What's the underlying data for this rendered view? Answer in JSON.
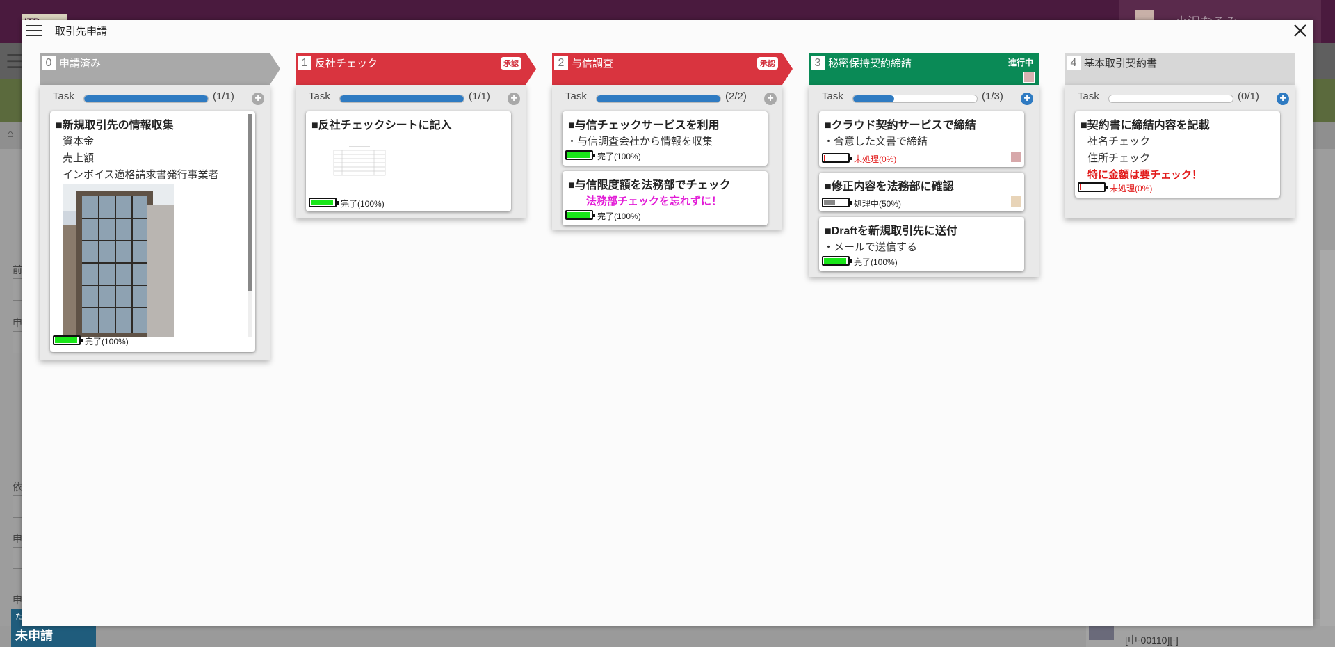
{
  "background": {
    "logo": "ITP",
    "user_name": "小沢なるみ",
    "field_labels": [
      "前",
      "申",
      "依",
      "申",
      "申"
    ],
    "status_badge": "未申請",
    "status_prefix": "た",
    "bottom_code": "[申-00110][-]"
  },
  "modal": {
    "title": "取引先申請",
    "task_label": "Task"
  },
  "colors": {
    "grey_stage": "#a9a9a9",
    "red_stage": "#d9343f",
    "green_stage": "#0a8a56",
    "light_stage": "#d7d7d7",
    "progress_fill": "#2f7bc2",
    "battery_full": "#19e619",
    "battery_half": "#888888",
    "battery_empty": "#e21b1b",
    "magenta_note": "#e21bd6",
    "red_note": "#e21b1b"
  },
  "stages": [
    {
      "num": "0",
      "name": "申請済み",
      "task_count": "(1/1)",
      "progress": 1.0,
      "cards": [
        {
          "title": "■新規取引先の情報収集",
          "lines": [
            "資本金",
            "売上額",
            "インボイス適格請求書発行事業者"
          ],
          "image": "building-photo",
          "status": "完了(100%)",
          "level": 1.0
        }
      ]
    },
    {
      "num": "1",
      "name": "反社チェック",
      "badge": "承認",
      "task_count": "(1/1)",
      "progress": 1.0,
      "cards": [
        {
          "title": "■反社チェックシートに記入",
          "image": "checksheet-thumbnail",
          "status": "完了(100%)",
          "level": 1.0
        }
      ]
    },
    {
      "num": "2",
      "name": "与信調査",
      "badge": "承認",
      "task_count": "(2/2)",
      "progress": 1.0,
      "cards": [
        {
          "title": "■与信チェックサービスを利用",
          "lines": [
            "・与信調査会社から情報を収集"
          ],
          "status": "完了(100%)",
          "level": 1.0
        },
        {
          "title": "■与信限度額を法務部でチェック",
          "note": "法務部チェックを忘れずに！",
          "status": "完了(100%)",
          "level": 1.0
        }
      ]
    },
    {
      "num": "3",
      "name": "秘密保持契約締結",
      "status": "進行中",
      "task_count": "(1/3)",
      "progress": 0.333,
      "cards": [
        {
          "title": "■クラウド契約サービスで締結",
          "lines": [
            "・合意した文書で締結"
          ],
          "status": "未処理(0%)",
          "level": 0
        },
        {
          "title": "■修正内容を法務部に確認",
          "status": "処理中(50%)",
          "level": 0.5
        },
        {
          "title": "■Draftを新規取引先に送付",
          "lines": [
            "・メールで送信する"
          ],
          "status": "完了(100%)",
          "level": 1.0
        }
      ]
    },
    {
      "num": "4",
      "name": "基本取引契約書",
      "task_count": "(0/1)",
      "progress": 0,
      "cards": [
        {
          "title": "■契約書に締結内容を記載",
          "lines": [
            "社名チェック",
            "住所チェック"
          ],
          "note": "特に金額は要チェック！",
          "status": "未処理(0%)",
          "level": 0
        }
      ]
    }
  ]
}
